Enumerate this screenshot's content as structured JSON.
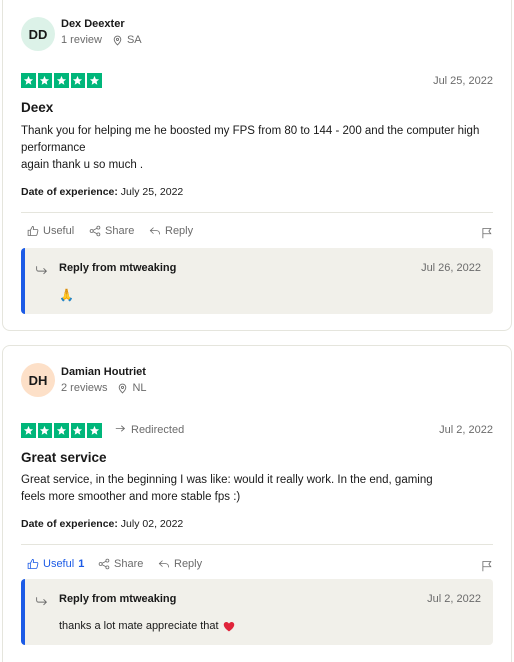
{
  "reviews": [
    {
      "avatar_initials": "DD",
      "name": "Dex Deexter",
      "review_count": "1 review",
      "country": "SA",
      "rating": 5,
      "redirected": "",
      "date": "Jul 25, 2022",
      "title": "Deex",
      "body_line1": "Thank you for helping me he boosted my FPS from 80 to 144 - 200 and the computer high performance",
      "body_line2": "again thank u so much .",
      "experience_label": "Date of experience:",
      "experience_date": "July 25, 2022",
      "useful_label": "Useful",
      "useful_count": "",
      "share_label": "Share",
      "reply_label": "Reply",
      "reply": {
        "from": "Reply from mtweaking",
        "date": "Jul 26, 2022",
        "text": "🙏"
      }
    },
    {
      "avatar_initials": "DH",
      "name": "Damian Houtriet",
      "review_count": "2 reviews",
      "country": "NL",
      "rating": 5,
      "redirected": "Redirected",
      "date": "Jul 2, 2022",
      "title": "Great service",
      "body_line1": "Great service, in the beginning I was like: would it really work. In the end, gaming",
      "body_line2": "feels more smoother and more stable fps :)",
      "experience_label": "Date of experience:",
      "experience_date": "July 02, 2022",
      "useful_label": "Useful",
      "useful_count": "1",
      "share_label": "Share",
      "reply_label": "Reply",
      "reply": {
        "from": "Reply from mtweaking",
        "date": "Jul 2, 2022",
        "text": "thanks a lot mate appreciate that"
      }
    }
  ],
  "colors": {
    "star_green": "#00b67a",
    "accent_blue": "#1c5be6",
    "reply_bg": "#f1f0ea"
  },
  "icons": [
    "location-pin-icon",
    "star-icon",
    "thumbs-up-icon",
    "share-icon",
    "reply-icon",
    "flag-icon",
    "reply-arrow-icon",
    "redirect-arrow-icon",
    "heart-icon"
  ]
}
